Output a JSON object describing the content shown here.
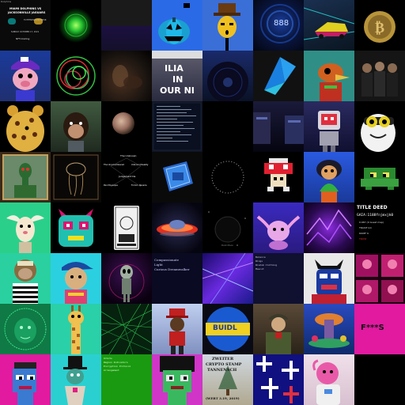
{
  "page": {
    "title": "NFT collection grid"
  },
  "grid": {
    "rows": 8,
    "cols": 8
  },
  "texts": {
    "t0": "Dolphins",
    "t1_title": "MIAMI DOLPHINS   VS",
    "t1_sub": "JACKSONVILLE JAGUARS",
    "t1_date": "SUNDAY OCTOBER 17, 2021",
    "t1_place": "TOTTENHAM HOTSPUR",
    "t1_tag": "NFTicketing",
    "t4_num": "888",
    "t13_a": "ILIA",
    "t13_b": "IN",
    "t13_c": "OUR NI",
    "t27_top": "The Unknown",
    "t27_l": "The Unremembered",
    "t27_r": "Unbound Reality",
    "t27_c": "Judgement Da",
    "t27_bl": "Pen Mosaique",
    "t27_br": "Forlorn Reverie",
    "t35_lbl": "Dark Moon",
    "t40_title": "TITLE DEED",
    "t40_id": "GAIA:1188fnjmxjk0",
    "t40_l1": "0.967 (0 Guest map)",
    "t40_l2": "TRASIT km",
    "t40_l3": "6908* K",
    "t40_l4": "TRUSt",
    "t44_l1": "Compassionate",
    "t44_l2": "Light",
    "t44_l3": "Curious Dreamwalker",
    "t46_l1": "Balance",
    "t46_l2": "Wings",
    "t46_l3": "Wisdom Clothing",
    "t46_l4": "Mascot",
    "t53_buidl": "BUIDL",
    "t56_text": "F***S",
    "t59_l1": "Orbits",
    "t59_l2": "Region Indicators",
    "t59_l3": "Encryption Protocol",
    "t59_l4": "Arrangement",
    "t62_l1": "ZWEITER",
    "t62_l2": "CRYPTO STAMP",
    "t62_l3": "TANNENSCH",
    "t62_l4": "(WERT 3.19, 2019)"
  },
  "tiles": [
    {
      "name": "tile-miami-ticket",
      "bg": "#0a0a0a"
    },
    {
      "name": "tile-green-orb",
      "bg": "#000000"
    },
    {
      "name": "tile-dark-purple-gradient",
      "bg": "#16102a"
    },
    {
      "name": "tile-blue-pumpkin",
      "bg": "#2b6ae6"
    },
    {
      "name": "tile-hat-character",
      "bg": "#3a6fd8"
    },
    {
      "name": "tile-888-tunnel",
      "bg": "#0a1640"
    },
    {
      "name": "tile-neon-car",
      "bg": "#0d1b2a"
    },
    {
      "name": "tile-bitcoin-coin",
      "bg": "#000000"
    },
    {
      "name": "tile-purple-cap-pig",
      "bg": "#1f3a8a"
    },
    {
      "name": "tile-scribble-orb",
      "bg": "#000000"
    },
    {
      "name": "tile-dark-painting",
      "bg": "#1a1410"
    },
    {
      "name": "tile-protest-poster",
      "bg": "#2a2a40"
    },
    {
      "name": "tile-record-disc",
      "bg": "#0a1226"
    },
    {
      "name": "tile-blue-sail",
      "bg": "#111111"
    },
    {
      "name": "tile-skull-bird",
      "bg": "#2f8f86"
    },
    {
      "name": "tile-band-photo",
      "bg": "#111111"
    },
    {
      "name": "tile-leopard-bear",
      "bg": "#000000"
    },
    {
      "name": "tile-monkey-art",
      "bg": "#304030"
    },
    {
      "name": "tile-moon-orb",
      "bg": "#000000"
    },
    {
      "name": "tile-terminal-text",
      "bg": "#101520"
    },
    {
      "name": "tile-black",
      "bg": "#000000"
    },
    {
      "name": "tile-spaceship-interior",
      "bg": "#0a0a20"
    },
    {
      "name": "tile-robot-gamer",
      "bg": "#1a1a40"
    },
    {
      "name": "tile-yellow-goggles-avatar",
      "bg": "#000000"
    },
    {
      "name": "tile-green-creature-frame",
      "bg": "#2a2015"
    },
    {
      "name": "tile-jellyfish-dark",
      "bg": "#0a0806"
    },
    {
      "name": "tile-tarot-diagram",
      "bg": "#000000"
    },
    {
      "name": "tile-blue-box",
      "bg": "#0a0a0a"
    },
    {
      "name": "tile-dot-circle",
      "bg": "#000000"
    },
    {
      "name": "tile-pixel-mushroom",
      "bg": "#000000"
    },
    {
      "name": "tile-plant-pet",
      "bg": "#1f3a8a"
    },
    {
      "name": "tile-green-frog-pixel",
      "bg": "#000000"
    },
    {
      "name": "tile-winged-creature",
      "bg": "#2ad08a"
    },
    {
      "name": "tile-neon-cat-face",
      "bg": "#000000"
    },
    {
      "name": "tile-tarot-card",
      "bg": "#000000"
    },
    {
      "name": "tile-red-ufo",
      "bg": "#050510"
    },
    {
      "name": "tile-dark-planet",
      "bg": "#000000"
    },
    {
      "name": "tile-pink-axolotl",
      "bg": "#2a22a8"
    },
    {
      "name": "tile-purple-energy",
      "bg": "#1a0a30"
    },
    {
      "name": "tile-title-deed",
      "bg": "#000000"
    },
    {
      "name": "tile-bored-ape-striped",
      "bg": "#2ad0a0"
    },
    {
      "name": "tile-blue-hat-ape",
      "bg": "#2ad0e0"
    },
    {
      "name": "tile-alien-neon",
      "bg": "#1a0a20"
    },
    {
      "name": "tile-trait-text",
      "bg": "#0a0a22"
    },
    {
      "name": "tile-blue-purple-lights",
      "bg": "#2a1a8a"
    },
    {
      "name": "tile-trait-list",
      "bg": "#101030"
    },
    {
      "name": "tile-samurai-mask",
      "bg": "#e8e8e8"
    },
    {
      "name": "tile-pink-portraits",
      "bg": "#1a0010"
    },
    {
      "name": "tile-green-lion",
      "bg": "#0f7a45"
    },
    {
      "name": "tile-giraffe",
      "bg": "#2ad0a8"
    },
    {
      "name": "tile-green-web",
      "bg": "#06220e"
    },
    {
      "name": "tile-red-hat-character",
      "bg": "#a8b8e8"
    },
    {
      "name": "tile-buidl-ball",
      "bg": "#0a0a14"
    },
    {
      "name": "tile-soldier",
      "bg": "#40362a"
    },
    {
      "name": "tile-fantasy-tower",
      "bg": "#0e2a6a"
    },
    {
      "name": "tile-magenta-text",
      "bg": "#e11aa0"
    },
    {
      "name": "tile-pixel-punk",
      "bg": "#e11aa0"
    },
    {
      "name": "tile-top-hat-figure",
      "bg": "#2ad0d0"
    },
    {
      "name": "tile-green-text",
      "bg": "#1a9a10"
    },
    {
      "name": "tile-pixel-afro",
      "bg": "#d035c8"
    },
    {
      "name": "tile-crypto-stamp",
      "bg": "#e8e0d0"
    },
    {
      "name": "tile-cross-pattern",
      "bg": "#101080"
    },
    {
      "name": "tile-pink-astronaut",
      "bg": "#e9d1e0"
    }
  ]
}
